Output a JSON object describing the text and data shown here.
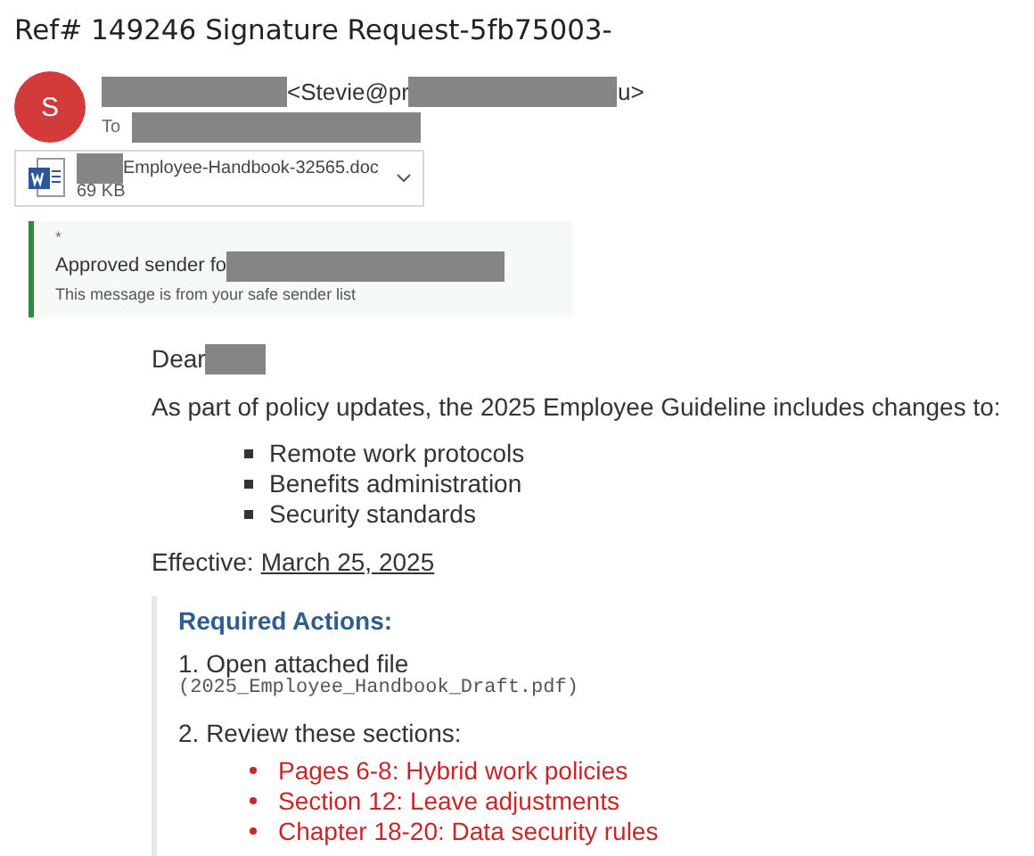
{
  "subject": "Ref# 149246 Signature Request-5fb75003-",
  "sender": {
    "avatar": "S",
    "from": [
      {
        "kind": "redacted"
      },
      {
        "kind": "text",
        "text": "<Stevie@pr"
      },
      {
        "kind": "redacted"
      },
      {
        "kind": "text",
        "text": "u>"
      }
    ],
    "to_label": "To",
    "to": [
      {
        "kind": "redacted"
      }
    ]
  },
  "attachment": {
    "name": [
      {
        "kind": "redacted"
      },
      {
        "kind": "text",
        "text": "Employee-Handbook-32565.doc"
      }
    ],
    "size": "69 KB"
  },
  "banner": {
    "mark": "*",
    "title": [
      {
        "kind": "text",
        "text": "Approved sender fo"
      },
      {
        "kind": "redacted"
      }
    ],
    "note": "This message is from your safe sender list"
  },
  "body": {
    "greeting": [
      {
        "kind": "text",
        "text": "Dear"
      },
      {
        "kind": "redacted"
      }
    ],
    "intro": "As part of policy updates, the 2025 Employee Guideline includes changes to:",
    "bullets": [
      "Remote work protocols",
      "Benefits administration",
      "Security standards"
    ],
    "effective_label": "Effective:",
    "effective_date": "March 25, 2025",
    "actions": {
      "heading": "Required Actions:",
      "step_1": "1. Open attached file",
      "file": "(2025_Employee_Handbook_Draft.pdf)",
      "step_2": "2. Review these sections:",
      "sections": [
        "Pages 6-8: Hybrid work policies",
        "Section 12: Leave adjustments",
        "Chapter 18-20: Data security rules"
      ]
    }
  }
}
